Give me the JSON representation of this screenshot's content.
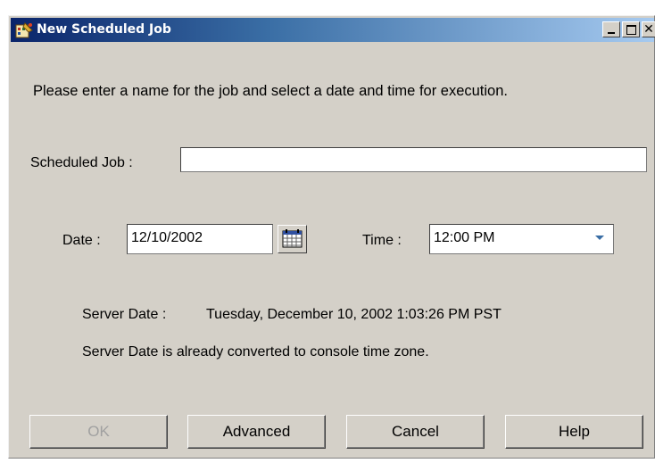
{
  "window": {
    "title": "New Scheduled Job",
    "controls": [
      "minimize",
      "maximize",
      "close"
    ]
  },
  "instructions": "Please enter a name for the job and select a date and time for execution.",
  "job": {
    "label": "Scheduled Job :",
    "value": ""
  },
  "date": {
    "label": "Date :",
    "value": "12/10/2002",
    "picker_icon": "calendar-icon"
  },
  "time": {
    "label": "Time :",
    "value": "12:00 PM"
  },
  "server": {
    "label": "Server Date :",
    "value": "Tuesday, December 10, 2002 1:03:26 PM PST",
    "note": "Server Date is already converted to console time zone."
  },
  "buttons": {
    "ok": "OK",
    "advanced": "Advanced",
    "cancel": "Cancel",
    "help": "Help"
  },
  "colors": {
    "title_gradient_start": "#0a246a",
    "title_gradient_end": "#a6caf0",
    "dialog_background": "#d4d0c8",
    "disabled_text": "#a0a0a0"
  }
}
